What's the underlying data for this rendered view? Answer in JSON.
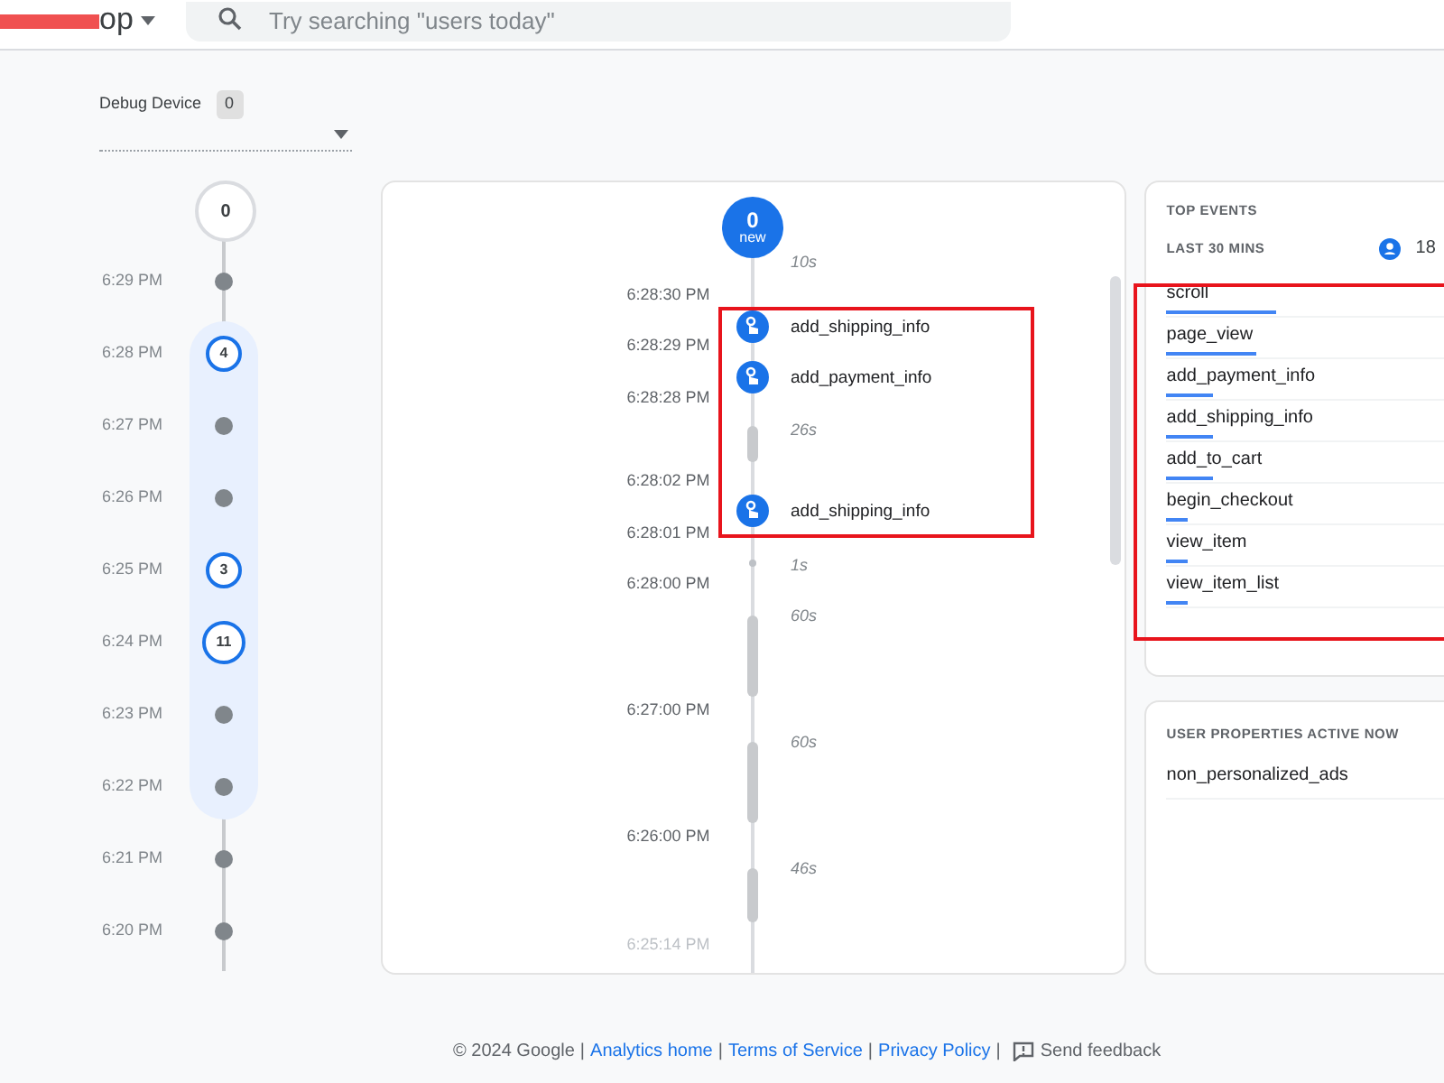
{
  "header": {
    "property_name": "op",
    "search": {
      "placeholder": "Try searching \"users today\""
    }
  },
  "debug_device": {
    "label": "Debug Device",
    "count": "0"
  },
  "minutes": {
    "counter": "0",
    "items": [
      {
        "time": "6:29 PM",
        "selected": false
      },
      {
        "time": "6:28 PM",
        "count": "4",
        "selected": true
      },
      {
        "time": "6:27 PM",
        "selected": true
      },
      {
        "time": "6:26 PM",
        "selected": true
      },
      {
        "time": "6:25 PM",
        "count": "3",
        "selected": true
      },
      {
        "time": "6:24 PM",
        "count": "11",
        "selected": true
      },
      {
        "time": "6:23 PM",
        "selected": true
      },
      {
        "time": "6:22 PM",
        "selected": true
      },
      {
        "time": "6:21 PM",
        "selected": false
      },
      {
        "time": "6:20 PM",
        "selected": false
      }
    ]
  },
  "seconds": {
    "new_count": "0",
    "new_label": "new",
    "times": [
      "6:28:30 PM",
      "6:28:29 PM",
      "6:28:28 PM",
      "6:28:02 PM",
      "6:28:01 PM",
      "6:28:00 PM",
      "6:27:00 PM",
      "6:26:00 PM",
      "6:25:14 PM"
    ],
    "events": [
      "add_shipping_info",
      "add_payment_info",
      "add_shipping_info"
    ],
    "gaps": [
      "10s",
      "26s",
      "1s",
      "60s",
      "60s",
      "46s"
    ]
  },
  "top_events": {
    "title": "TOP EVENTS",
    "subtitle": "LAST 30 MINS",
    "user_count": "18",
    "items": [
      {
        "name": "scroll",
        "level": 0.36
      },
      {
        "name": "page_view",
        "level": 0.29
      },
      {
        "name": "add_payment_info",
        "level": 0.15
      },
      {
        "name": "add_shipping_info",
        "level": 0.15
      },
      {
        "name": "add_to_cart",
        "level": 0.15
      },
      {
        "name": "begin_checkout",
        "level": 0.07
      },
      {
        "name": "view_item",
        "level": 0.07
      },
      {
        "name": "view_item_list",
        "level": 0.07
      }
    ]
  },
  "user_properties": {
    "title": "USER PROPERTIES ACTIVE NOW",
    "items": [
      "non_personalized_ads"
    ]
  },
  "footer": {
    "copyright": "© 2024 Google",
    "links": [
      "Analytics home",
      "Terms of Service",
      "Privacy Policy"
    ],
    "separators": [
      "|",
      "|",
      "|",
      "|"
    ],
    "feedback": "Send feedback"
  }
}
